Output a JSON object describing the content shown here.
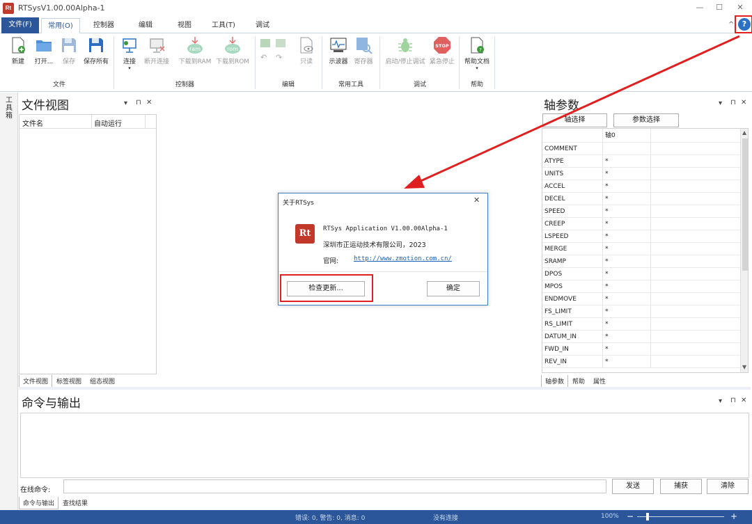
{
  "window": {
    "title": "RTSysV1.00.00Alpha-1",
    "minimize": "—",
    "maximize": "☐",
    "close": "✕"
  },
  "menu_tabs": [
    {
      "label": "文件(F)"
    },
    {
      "label": "常用(O)"
    },
    {
      "label": "控制器(C)"
    },
    {
      "label": "编辑(E)"
    },
    {
      "label": "视图(V)"
    },
    {
      "label": "工具(T)"
    },
    {
      "label": "调试(D)"
    }
  ],
  "ribbon": {
    "file": {
      "new": "新建",
      "open": "打开...",
      "save": "保存",
      "save_all": "保存所有",
      "group": "文件"
    },
    "controller": {
      "connect": "连接",
      "disconnect": "断开连接",
      "download_ram": "下载到RAM",
      "download_rom": "下载到ROM",
      "ram_badge": "ram",
      "rom_badge": "rom",
      "group": "控制器"
    },
    "edit": {
      "readonly": "只读",
      "group": "编辑"
    },
    "tools": {
      "oscilloscope": "示波器",
      "registers": "寄存器",
      "group": "常用工具"
    },
    "debug": {
      "start_stop": "启动/停止调试",
      "emergency": "紧急停止",
      "stop_badge": "STOP",
      "group": "调试"
    },
    "help": {
      "help_doc": "帮助文档",
      "group": "帮助"
    },
    "collapse": "^",
    "help_icon": "?"
  },
  "side_toolstrip": {
    "label": "工具箱"
  },
  "file_view": {
    "title": "文件视图",
    "columns": [
      "文件名",
      "自动运行"
    ],
    "tabs": [
      "文件视图",
      "标签视图",
      "组态视图"
    ]
  },
  "axis_view": {
    "title": "轴参数",
    "btn_axis_select": "轴选择",
    "btn_param_select": "参数选择",
    "column": "轴0",
    "rows": [
      {
        "name": "COMMENT",
        "value": ""
      },
      {
        "name": "ATYPE",
        "value": "*"
      },
      {
        "name": "UNITS",
        "value": "*"
      },
      {
        "name": "ACCEL",
        "value": "*"
      },
      {
        "name": "DECEL",
        "value": "*"
      },
      {
        "name": "SPEED",
        "value": "*"
      },
      {
        "name": "CREEP",
        "value": "*"
      },
      {
        "name": "LSPEED",
        "value": "*"
      },
      {
        "name": "MERGE",
        "value": "*"
      },
      {
        "name": "SRAMP",
        "value": "*"
      },
      {
        "name": "DPOS",
        "value": "*"
      },
      {
        "name": "MPOS",
        "value": "*"
      },
      {
        "name": "ENDMOVE",
        "value": "*"
      },
      {
        "name": "FS_LIMIT",
        "value": "*"
      },
      {
        "name": "RS_LIMIT",
        "value": "*"
      },
      {
        "name": "DATUM_IN",
        "value": "*"
      },
      {
        "name": "FWD_IN",
        "value": "*"
      },
      {
        "name": "REV_IN",
        "value": "*"
      }
    ],
    "tabs": [
      "轴参数",
      "帮助",
      "属性"
    ]
  },
  "command_panel": {
    "title": "命令与输出",
    "online_label": "在线命令:",
    "send": "发送",
    "capture": "捕获",
    "clear": "清除",
    "tabs": [
      "命令与输出",
      "查找结果"
    ]
  },
  "panel_controls": {
    "dropdown": "▾",
    "pin": "⊓",
    "close": "✕"
  },
  "about_dialog": {
    "title": "关于RTSys",
    "logo": "Rt",
    "app_line": "RTSys Application V1.00.00Alpha-1",
    "company_line": "深圳市正运动技术有限公司，2023",
    "website_label": "官网:",
    "website_url": "http://www.zmotion.com.cn/",
    "check_update": "检查更新...",
    "ok": "确定",
    "close": "✕"
  },
  "status_bar": {
    "messages": "错误: 0, 警告: 0, 消息: 0",
    "connection": "没有连接",
    "zoom": "100%",
    "zoom_minus": "−",
    "zoom_plus": "+"
  },
  "colors": {
    "accent": "#2b579a",
    "highlight": "#e02020",
    "arrow": "#e02020"
  }
}
